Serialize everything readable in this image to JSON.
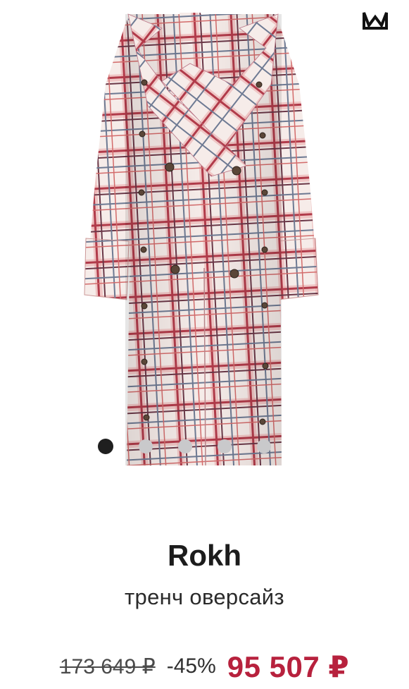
{
  "product": {
    "brand": "Rokh",
    "name": "тренч оверсайз",
    "old_price": "173 649 ₽",
    "discount": "-45%",
    "price": "95 507 ₽"
  },
  "gallery": {
    "total_slides": 5,
    "active_slide": 1
  },
  "colors": {
    "price_accent": "#b7213d",
    "dot_active": "#1f1f1f",
    "dot_inactive": "#c9c9cb",
    "plaid_red": "#c8505a",
    "plaid_base": "#f3e3df"
  },
  "icons": {
    "brand_logo": "crown-logo-icon"
  }
}
